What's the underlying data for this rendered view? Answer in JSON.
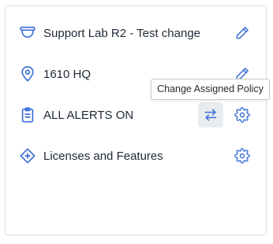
{
  "colors": {
    "accent": "#3b6fd8",
    "text": "#1f2937",
    "border": "#dcdcdc"
  },
  "rows": [
    {
      "label": "Support Lab R2 - Test change",
      "icon": "camera-dome-icon",
      "action_icon": "pencil-icon"
    },
    {
      "label": "1610 HQ",
      "icon": "map-pin-icon",
      "action_icon": "pencil-icon"
    },
    {
      "label": "ALL ALERTS ON",
      "icon": "clipboard-icon",
      "action_icons": [
        "swap-arrows-icon",
        "gear-icon"
      ]
    },
    {
      "label": "Licenses and Features",
      "icon": "diamond-plus-icon",
      "action_icon": "gear-icon"
    }
  ],
  "tooltip": {
    "text": "Change Assigned Policy"
  }
}
